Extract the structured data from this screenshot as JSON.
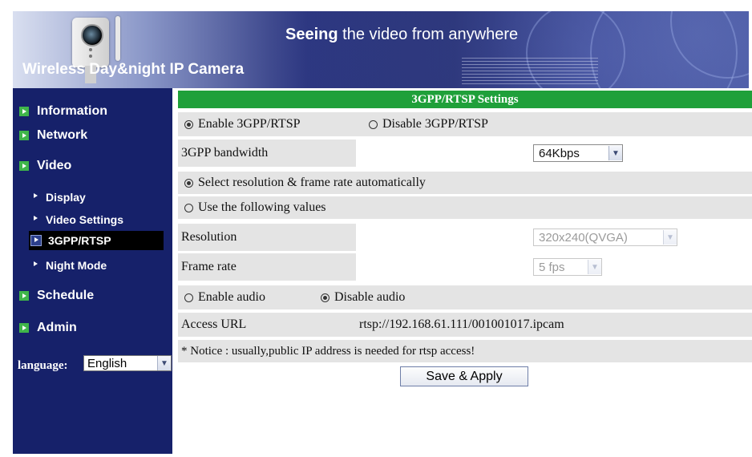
{
  "header": {
    "brand_part1": "Wireless ",
    "brand_part2": "Day&night IP Camera",
    "slogan_part1": "Seeing",
    "slogan_part2": " the video from anywhere",
    "camera_icon": "ip-camera-icon"
  },
  "sidebar": {
    "items": [
      {
        "label": "Information"
      },
      {
        "label": "Network"
      },
      {
        "label": "Video"
      },
      {
        "label": "Display"
      },
      {
        "label": "Video Settings"
      },
      {
        "label": "3GPP/RTSP",
        "active": true
      },
      {
        "label": "Night Mode"
      },
      {
        "label": "Schedule"
      },
      {
        "label": "Admin"
      }
    ],
    "language_label": "language:",
    "language_value": "English"
  },
  "main": {
    "title": "3GPP/RTSP Settings",
    "enable_label": "Enable 3GPP/RTSP",
    "disable_label": "Disable 3GPP/RTSP",
    "bandwidth_label": "3GPP bandwidth",
    "bandwidth_value": "64Kbps",
    "auto_label": "Select resolution & frame rate automatically",
    "manual_label": "Use the following values",
    "resolution_label": "Resolution",
    "resolution_value": "320x240(QVGA)",
    "framerate_label": "Frame rate",
    "framerate_value": "5 fps",
    "enable_audio_label": "Enable audio",
    "disable_audio_label": "Disable audio",
    "access_url_label": "Access URL",
    "access_url_value": "rtsp://192.168.61.111/001001017.ipcam",
    "notice": "* Notice : usually,public IP address is needed for rtsp access!",
    "save_button": "Save & Apply"
  },
  "state": {
    "rtsp_enabled": true,
    "auto_resolution": true,
    "audio_enabled": false
  },
  "colors": {
    "sidebar_bg": "#16216a",
    "title_bar_green": "#1fa03a",
    "row_gray": "#e4e4e4",
    "nav_bullet_green": "#3fb54a"
  }
}
